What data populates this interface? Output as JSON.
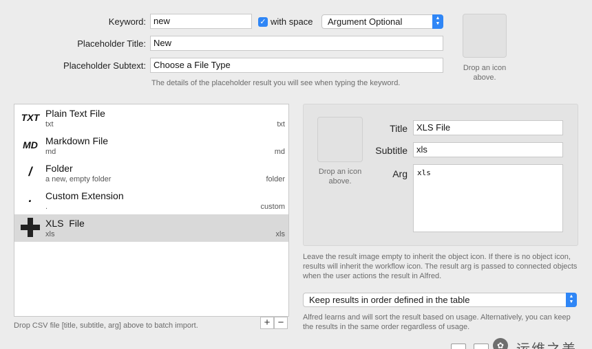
{
  "header": {
    "keyword_label": "Keyword:",
    "keyword_value": "new",
    "with_space_label": "with space",
    "argument_mode": "Argument Optional",
    "placeholder_title_label": "Placeholder Title:",
    "placeholder_title_value": "New",
    "placeholder_subtext_label": "Placeholder Subtext:",
    "placeholder_subtext_value": "Choose a File Type",
    "placeholder_hint": "The details of the placeholder result you will see when typing the keyword.",
    "drop_icon_text": "Drop an icon above."
  },
  "list": {
    "items": [
      {
        "icon": "TXT",
        "title": "Plain Text File",
        "subtitle": "txt",
        "arg": "txt"
      },
      {
        "icon": "MD",
        "title": "Markdown File",
        "subtitle": "md",
        "arg": "md"
      },
      {
        "icon": "/",
        "title": "Folder",
        "subtitle": "a new, empty folder",
        "arg": "folder"
      },
      {
        "icon": ".",
        "title": "Custom Extension",
        "subtitle": ".",
        "arg": "custom"
      },
      {
        "icon": "plus-icon",
        "title": "XLS  File",
        "subtitle": "xls",
        "arg": "xls"
      }
    ],
    "footer_hint": "Drop CSV file [title, subtitle, arg] above to batch import.",
    "add_label": "+",
    "remove_label": "−"
  },
  "detail": {
    "drop_icon_text": "Drop an icon above.",
    "title_label": "Title",
    "title_value": "XLS  File",
    "subtitle_label": "Subtitle",
    "subtitle_value": "xls",
    "arg_label": "Arg",
    "arg_value": "xls"
  },
  "notes": {
    "inherit_hint": "Leave the result image empty to inherit the object icon. If there is no object icon, results will inherit the workflow icon. The result arg is passed to connected objects when the user actions the result in Alfred.",
    "order_option": "Keep results in order defined in the table",
    "order_hint": "Alfred learns and will sort the result based on usage. Alternatively, you can keep the results in the same order regardless of usage."
  },
  "watermark": "运维之美",
  "colors": {
    "accent": "#2f86f6",
    "selected_row": "#d9d9d9"
  }
}
